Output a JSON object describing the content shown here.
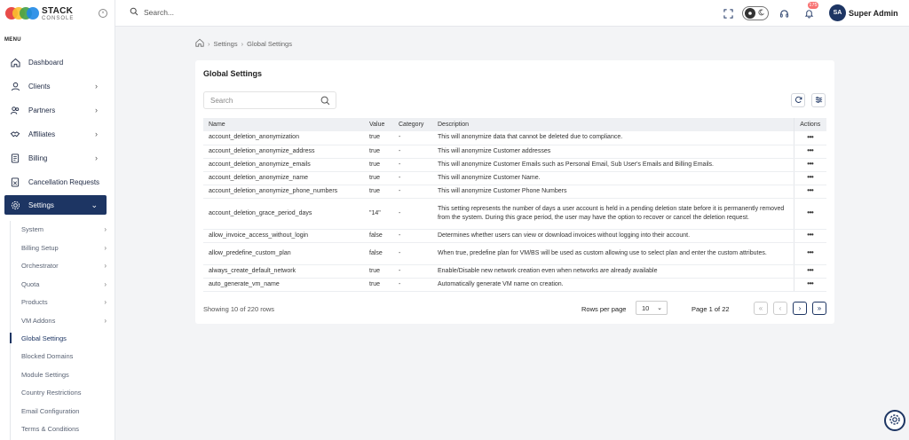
{
  "brand": {
    "name": "STACK",
    "sub": "CONSOLE"
  },
  "sidebar": {
    "menu_label": "MENU",
    "items": [
      {
        "label": "Dashboard"
      },
      {
        "label": "Clients"
      },
      {
        "label": "Partners"
      },
      {
        "label": "Affiliates"
      },
      {
        "label": "Billing"
      },
      {
        "label": "Cancellation Requests"
      },
      {
        "label": "Settings"
      }
    ],
    "sub_items": [
      {
        "label": "System"
      },
      {
        "label": "Billing Setup"
      },
      {
        "label": "Orchestrator"
      },
      {
        "label": "Quota"
      },
      {
        "label": "Products"
      },
      {
        "label": "VM Addons"
      },
      {
        "label": "Global Settings"
      },
      {
        "label": "Blocked Domains"
      },
      {
        "label": "Module Settings"
      },
      {
        "label": "Country Restrictions"
      },
      {
        "label": "Email Configuration"
      },
      {
        "label": "Terms & Conditions"
      }
    ]
  },
  "header": {
    "search_text": "Search...",
    "notification_count": "175",
    "avatar_initials": "SA",
    "user_name": "Super Admin"
  },
  "breadcrumb": {
    "level1": "Settings",
    "level2": "Global Settings"
  },
  "page": {
    "title": "Global Settings",
    "search_placeholder": "Search"
  },
  "table": {
    "columns": {
      "name": "Name",
      "value": "Value",
      "category": "Category",
      "description": "Description",
      "actions": "Actions"
    },
    "action_glyph": "•••",
    "rows": [
      {
        "name": "account_deletion_anonymization",
        "value": "true",
        "category": "-",
        "description": "This will anonymize data that cannot be deleted due to compliance."
      },
      {
        "name": "account_deletion_anonymize_address",
        "value": "true",
        "category": "-",
        "description": "This will anonymize Customer addresses"
      },
      {
        "name": "account_deletion_anonymize_emails",
        "value": "true",
        "category": "-",
        "description": "This will anonymize Customer Emails such as Personal Email, Sub User's Emails and Billing Emails."
      },
      {
        "name": "account_deletion_anonymize_name",
        "value": "true",
        "category": "-",
        "description": "This will anonymize Customer Name."
      },
      {
        "name": "account_deletion_anonymize_phone_numbers",
        "value": "true",
        "category": "-",
        "description": "This will anonymize Customer Phone Numbers"
      },
      {
        "name": "account_deletion_grace_period_days",
        "value": "\"14\"",
        "category": "-",
        "description": "This setting represents the number of days a user account is held in a pending deletion state before it is permanently removed from the system. During this grace period, the user may have the option to recover or cancel the deletion request."
      },
      {
        "name": "allow_invoice_access_without_login",
        "value": "false",
        "category": "-",
        "description": "Determines whether users can view or download invoices without logging into their account."
      },
      {
        "name": "allow_predefine_custom_plan",
        "value": "false",
        "category": "-",
        "description": "When true, predefine plan for VM/BS will be used as custom allowing use to select plan and enter the custom attributes."
      },
      {
        "name": "always_create_default_network",
        "value": "true",
        "category": "-",
        "description": "Enable/Disable new network creation even when networks are already available"
      },
      {
        "name": "auto_generate_vm_name",
        "value": "true",
        "category": "-",
        "description": "Automatically generate VM name on creation."
      }
    ]
  },
  "pagination": {
    "showing_text": "Showing 10 of 220 rows",
    "rows_per_page_label": "Rows per page",
    "rows_per_page_value": "10",
    "page_info": "Page 1 of 22"
  },
  "colors": {
    "primary": "#1d3563",
    "badge": "#f87171"
  }
}
